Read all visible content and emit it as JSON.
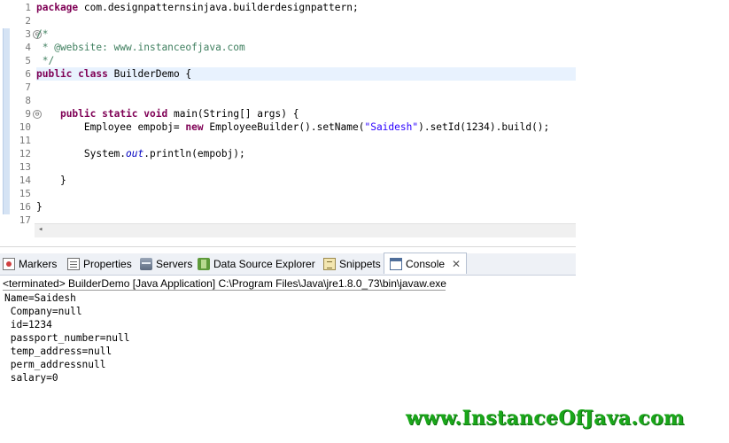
{
  "editor": {
    "line_numbers": [
      "1",
      "2",
      "3",
      "4",
      "5",
      "6",
      "7",
      "8",
      "9",
      "10",
      "11",
      "12",
      "13",
      "14",
      "15",
      "16",
      "17"
    ],
    "fold_markers": [
      "⊖",
      "⊖"
    ],
    "lines": [
      [
        {
          "t": "package",
          "c": "kw"
        },
        {
          "t": " com.designpatternsinjava.builderdesignpattern;"
        }
      ],
      [],
      [
        {
          "t": "/*",
          "c": "cm"
        }
      ],
      [
        {
          "t": " * @website: www.instanceofjava.com",
          "c": "cm"
        }
      ],
      [
        {
          "t": " */",
          "c": "cm"
        }
      ],
      [
        {
          "t": "public",
          "c": "kw"
        },
        {
          "t": " "
        },
        {
          "t": "class",
          "c": "kw"
        },
        {
          "t": " BuilderDemo {"
        }
      ],
      [],
      [],
      [
        {
          "t": "    "
        },
        {
          "t": "public",
          "c": "kw"
        },
        {
          "t": " "
        },
        {
          "t": "static",
          "c": "kw"
        },
        {
          "t": " "
        },
        {
          "t": "void",
          "c": "kw"
        },
        {
          "t": " main(String[] args) {"
        }
      ],
      [
        {
          "t": "        Employee empobj= "
        },
        {
          "t": "new",
          "c": "kw"
        },
        {
          "t": " EmployeeBuilder().setName("
        },
        {
          "t": "\"Saidesh\"",
          "c": "str"
        },
        {
          "t": ").setId(1234).build();"
        }
      ],
      [],
      [
        {
          "t": "        System."
        },
        {
          "t": "out",
          "c": "fld"
        },
        {
          "t": ".println(empobj);"
        }
      ],
      [],
      [
        {
          "t": "    }"
        }
      ],
      [],
      [
        {
          "t": "}"
        }
      ],
      []
    ]
  },
  "tabs": [
    {
      "label": "Markers",
      "icon": "markers-icon"
    },
    {
      "label": "Properties",
      "icon": "properties-icon"
    },
    {
      "label": "Servers",
      "icon": "servers-icon"
    },
    {
      "label": "Data Source Explorer",
      "icon": "data-source-explorer-icon"
    },
    {
      "label": "Snippets",
      "icon": "snippets-icon"
    },
    {
      "label": "Console",
      "icon": "console-icon",
      "active": true,
      "close": "✕"
    }
  ],
  "console": {
    "header": "<terminated> BuilderDemo [Java Application] C:\\Program Files\\Java\\jre1.8.0_73\\bin\\javaw.exe",
    "output": [
      "Name=Saidesh",
      " Company=null",
      " id=1234",
      " passport_number=null",
      " temp_address=null",
      " perm_addressnull",
      " salary=0"
    ]
  },
  "watermark": "www.InstanceOfJava.com",
  "scroll_arrow": "◂"
}
